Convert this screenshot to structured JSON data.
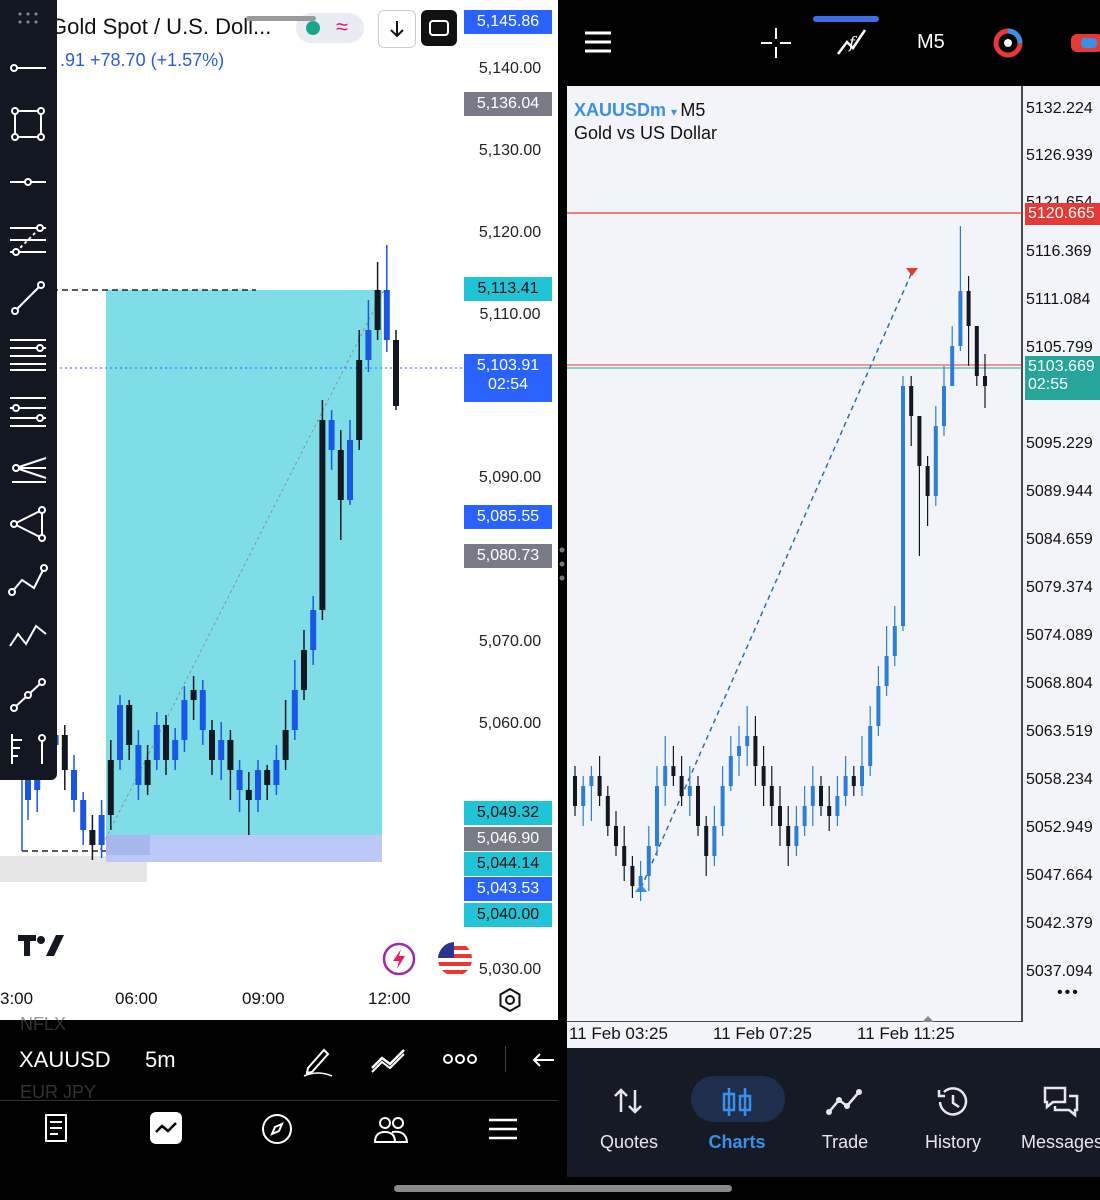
{
  "left": {
    "title": "Gold Spot / U.S. Doll...",
    "price_change": ".91  +78.70 (+1.57%)",
    "axis_labels": [
      "5,140.00",
      "5,130.00",
      "5,120.00",
      "5,110.00",
      "5,090.00",
      "5,070.00",
      "5,060.00",
      "5,030.00"
    ],
    "price_tags": {
      "top": "5,145.86",
      "high_grey": "5,136.04",
      "tp": "5,113.41",
      "current": "5,103.91",
      "countdown": "02:54",
      "blue_mid": "5,085.55",
      "grey_mid": "5,080.73",
      "entry": "5,049.32",
      "grey_low": "5,046.90",
      "sl_cyan": "5,044.14",
      "blue_low": "5,043.53",
      "cyan_low": "5,040.00"
    },
    "time_labels": [
      "3:00",
      "06:00",
      "09:00",
      "12:00"
    ],
    "watch_ghost_top": "NFLX",
    "symbol": "XAUUSD",
    "interval": "5m",
    "watch_ghost_bottom": "EUR JPY",
    "colors": {
      "box": "#7fdde8",
      "sl_box": "#bcc8f8",
      "candle": "#1a56e6",
      "candle_dark": "#131722"
    }
  },
  "right": {
    "top_interval": "M5",
    "symbol": "XAUUSDm",
    "interval": "M5",
    "description": "Gold vs US Dollar",
    "axis_labels": [
      "5132.224",
      "5126.939",
      "5116.369",
      "5111.084",
      "5105.799",
      "5095.229",
      "5089.944",
      "5084.659",
      "5079.374",
      "5074.089",
      "5068.804",
      "5063.519",
      "5058.234",
      "5052.949",
      "5047.664",
      "5042.379",
      "5037.094"
    ],
    "partial_label": "5121.654",
    "red_tag": "5120.665",
    "bid_tag": "5103.669",
    "countdown": "02:55",
    "time_labels": [
      "11 Feb 03:25",
      "11 Feb 07:25",
      "11 Feb 11:25"
    ],
    "more": "•••",
    "nav": [
      "Quotes",
      "Charts",
      "Trade",
      "History",
      "Messages"
    ],
    "colors": {
      "accent": "#3a8fe8",
      "red": "#e53935",
      "teal": "#26a69a"
    }
  }
}
